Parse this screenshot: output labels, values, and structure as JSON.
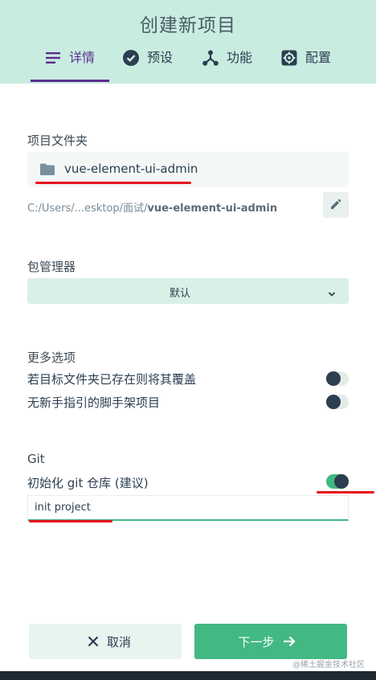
{
  "header": {
    "title": "创建新项目",
    "tabs": [
      {
        "label": "详情",
        "icon": "list-icon",
        "active": true
      },
      {
        "label": "预设",
        "icon": "check-circle-icon",
        "active": false
      },
      {
        "label": "功能",
        "icon": "nodes-icon",
        "active": false
      },
      {
        "label": "配置",
        "icon": "gear-icon",
        "active": false
      }
    ],
    "accent_color": "#5c2d91",
    "background_color": "#c9ece0"
  },
  "folder": {
    "label": "项目文件夹",
    "name": "vue-element-ui-admin",
    "path_prefix": "C:/Users/...esktop/面试/",
    "path_name": "vue-element-ui-admin"
  },
  "package_manager": {
    "label": "包管理器",
    "selected": "默认"
  },
  "more_options": {
    "label": "更多选项",
    "items": [
      {
        "label": "若目标文件夹已存在则将其覆盖",
        "enabled": false
      },
      {
        "label": "无新手指引的脚手架项目",
        "enabled": false
      }
    ]
  },
  "git": {
    "label": "Git",
    "init_label": "初始化 git 仓库 (建议)",
    "init_enabled": true,
    "commit_message": "init project"
  },
  "footer": {
    "cancel_label": "取消",
    "next_label": "下一步",
    "primary_color": "#42b883"
  },
  "watermark": "@稀土掘金技术社区"
}
